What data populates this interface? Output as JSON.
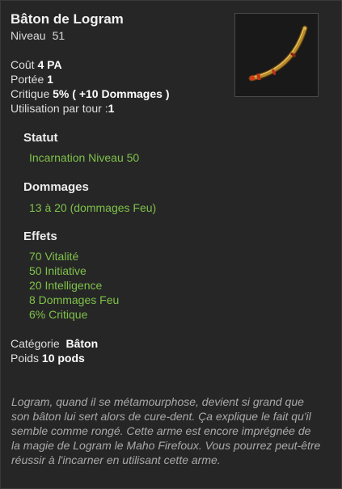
{
  "item": {
    "name": "Bâton de Logram",
    "level_label": "Niveau",
    "level_value": "51",
    "image_icon": "bent-staff-icon"
  },
  "stats": {
    "cost_label": "Coût",
    "cost_value": "4 PA",
    "range_label": "Portée",
    "range_value": "1",
    "crit_label": "Critique",
    "crit_value": "5% ( +10 Dommages )",
    "uses_label": "Utilisation par tour :",
    "uses_value": "1"
  },
  "statut": {
    "title": "Statut",
    "text": "Incarnation Niveau 50"
  },
  "dommages": {
    "title": "Dommages",
    "text": "13 à 20 (dommages Feu)"
  },
  "effets": {
    "title": "Effets",
    "items": [
      "70 Vitalité",
      "50 Initiative",
      "20 Intelligence",
      "8 Dommages Feu",
      "6% Critique"
    ]
  },
  "meta": {
    "category_label": "Catégorie",
    "category_value": "Bâton",
    "weight_label": "Poids",
    "weight_value": "10 pods"
  },
  "description": "Logram, quand il se métamourphose, devient si grand que son bâton lui sert alors de cure-dent. Ça explique le fait qu'il semble comme rongé. Cette arme est encore imprégnée de la magie de Logram le Maho Firefoux. Vous pourrez peut-être réussir à l'incarner en utilisant cette arme.",
  "colors": {
    "panel_bg": "#262626",
    "effect_green": "#7fc24a",
    "description_gray": "#a9a9a9"
  }
}
